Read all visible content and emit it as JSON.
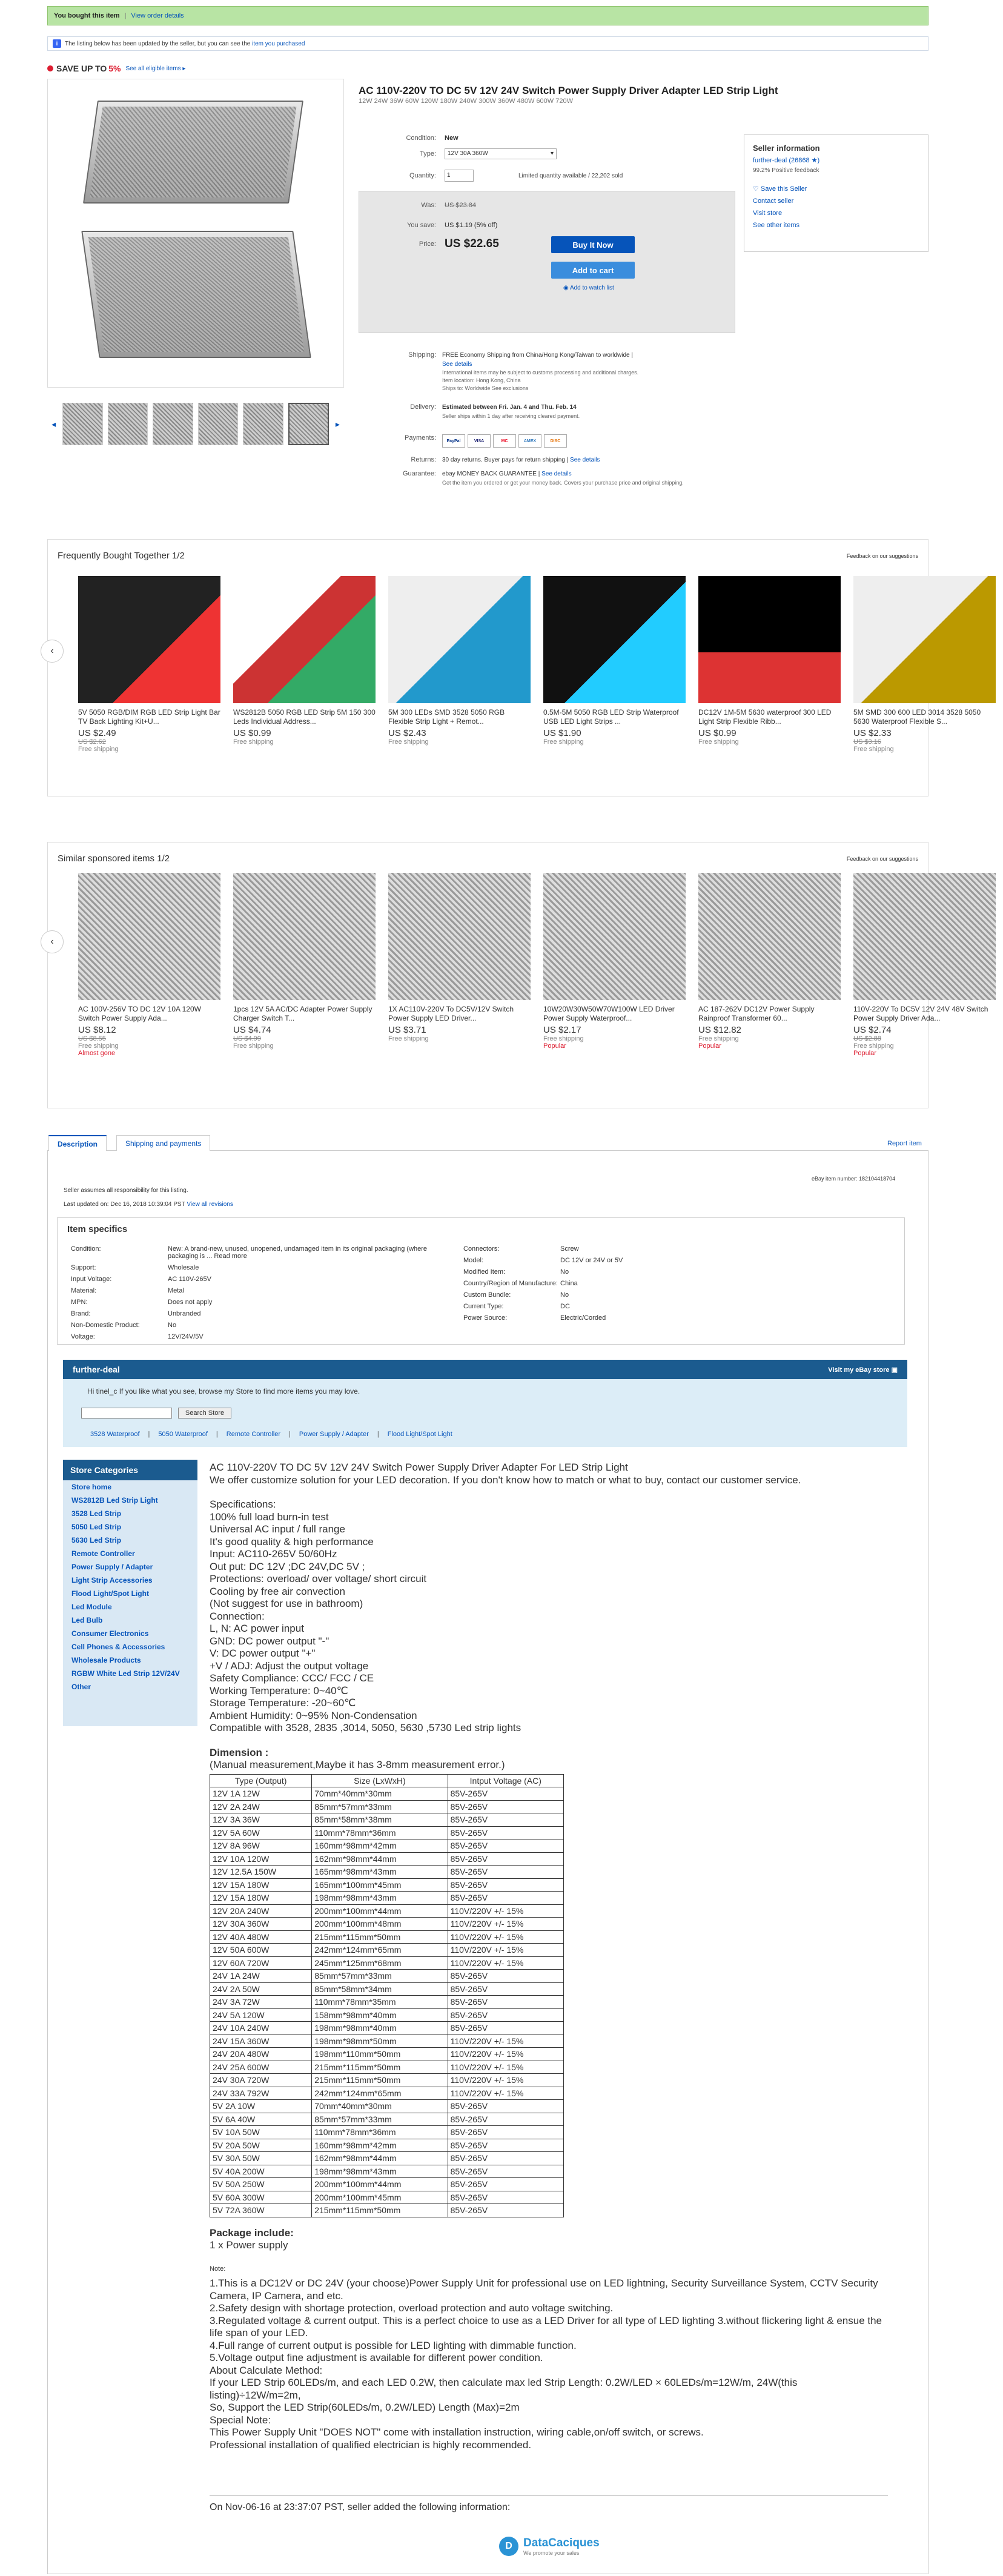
{
  "banner": {
    "bought": "You bought this item",
    "view_order": "View order details"
  },
  "update_notice": {
    "text": "The listing below has been updated by the seller, but you can see the",
    "link": "item you purchased"
  },
  "promo": {
    "save_up": "SAVE UP TO",
    "percent": "5%",
    "eligible": "See all eligible items ▸"
  },
  "item": {
    "title": "AC 110V-220V TO DC 5V 12V 24V Switch Power Supply Driver Adapter LED Strip Light",
    "subtitle": "12W 24W 36W 60W 120W 180W 240W 300W 360W 480W 600W 720W",
    "condition_label": "Condition:",
    "condition": "New",
    "type_label": "Type:",
    "type_value": "12V 30A 360W",
    "quantity_label": "Quantity:",
    "quantity": "1",
    "availability": "Limited quantity available / 22,202 sold",
    "was_label": "Was:",
    "was": "US $23.84",
    "save_label": "You save:",
    "save": "US $1.19 (5% off)",
    "price_label": "Price:",
    "price": "US $22.65",
    "buy_now": "Buy It Now",
    "add_cart": "Add to cart",
    "watch": "Add to watch list"
  },
  "seller": {
    "heading": "Seller information",
    "name": "further-deal",
    "feedback": "(26868 ★)",
    "positive": "99.2% Positive feedback",
    "save": "Save this Seller",
    "contact": "Contact seller",
    "visit": "Visit store",
    "other": "See other items"
  },
  "shipping": {
    "shipping_label": "Shipping:",
    "shipping": "FREE  Economy Shipping from China/Hong Kong/Taiwan to worldwide |",
    "see_details": "See details",
    "intl_note": "International items may be subject to customs processing and additional charges.",
    "location": "Item location:  Hong Kong, China",
    "ships_to": "Ships to:  Worldwide  See exclusions",
    "delivery_label": "Delivery:",
    "delivery": "Estimated between Fri. Jan. 4 and Thu. Feb. 14",
    "delivery_note": "Seller ships within 1 day after receiving cleared payment.",
    "payments_label": "Payments:",
    "payments": [
      "PayPal",
      "VISA",
      "MC",
      "AMEX",
      "DISC"
    ],
    "returns_label": "Returns:",
    "returns": "30 day returns. Buyer pays for return shipping |",
    "returns_link": "See details",
    "guarantee_label": "Guarantee:",
    "guarantee": "ebay MONEY BACK GUARANTEE |",
    "guarantee_link": "See details",
    "guarantee_note": "Get the item you ordered or get your money back. Covers your purchase price and original shipping."
  },
  "fbt": {
    "heading": "Frequently Bought Together",
    "pager": "1/2",
    "feedback": "Feedback on our suggestions",
    "items": [
      {
        "title": "5V 5050 RGB/DIM RGB LED Strip Light Bar TV Back Lighting Kit+U...",
        "price": "US $2.49",
        "old": "US $2.62",
        "ship": "Free shipping"
      },
      {
        "title": "WS2812B 5050 RGB LED Strip 5M 150 300 Leds Individual Address...",
        "price": "US $0.99",
        "old": "",
        "ship": "Free shipping"
      },
      {
        "title": "5M 300 LEDs SMD 3528 5050 RGB Flexible Strip Light + Remot...",
        "price": "US $2.43",
        "old": "",
        "ship": "Free shipping"
      },
      {
        "title": "0.5M-5M 5050 RGB LED Strip Waterproof USB LED Light Strips ...",
        "price": "US $1.90",
        "old": "",
        "ship": "Free shipping"
      },
      {
        "title": "DC12V 1M-5M 5630 waterproof 300 LED Light Strip Flexible Ribb...",
        "price": "US $0.99",
        "old": "",
        "ship": "Free shipping"
      },
      {
        "title": "5M SMD 300 600 LED 3014 3528 5050 5630 Waterproof Flexible S...",
        "price": "US $2.33",
        "old": "US $3.16",
        "ship": "Free shipping"
      }
    ]
  },
  "sponsored": {
    "heading": "Similar sponsored items",
    "pager": "1/2",
    "feedback": "Feedback on our suggestions",
    "items": [
      {
        "title": "AC 100V-256V TO DC 12V 10A 120W Switch Power Supply Ada...",
        "price": "US $8.12",
        "old": "US $8.55",
        "ship": "Free shipping",
        "tag": "Almost gone"
      },
      {
        "title": "1pcs 12V 5A AC/DC Adapter Power Supply Charger Switch T...",
        "price": "US $4.74",
        "old": "US $4.99",
        "ship": "Free shipping",
        "tag": ""
      },
      {
        "title": "1X AC110V-220V To DC5V/12V Switch Power Supply LED Driver...",
        "price": "US $3.71",
        "old": "",
        "ship": "Free shipping",
        "tag": ""
      },
      {
        "title": "10W20W30W50W70W100W LED Driver Power Supply Waterproof...",
        "price": "US $2.17",
        "old": "",
        "ship": "Free shipping",
        "tag": "Popular"
      },
      {
        "title": "AC 187-262V DC12V Power Supply Rainproof Transformer 60...",
        "price": "US $12.82",
        "old": "",
        "ship": "Free shipping",
        "tag": "Popular"
      },
      {
        "title": "110V-220V To DC5V 12V 24V 48V Switch Power Supply Driver Ada...",
        "price": "US $2.74",
        "old": "US $2.88",
        "ship": "Free shipping",
        "tag": "Popular"
      }
    ]
  },
  "desc_tabs": {
    "description": "Description",
    "shipping": "Shipping and payments",
    "report": "Report item"
  },
  "desc_meta": {
    "responsibility": "Seller assumes all responsibility for this listing.",
    "last_updated": "Last updated on:  Dec 16, 2018 10:39:04 PST",
    "revisions": "View all revisions",
    "ebay_no": "eBay item number:    182104418704"
  },
  "specifics": {
    "heading": "Item specifics",
    "left": [
      {
        "k": "Condition:",
        "v": "New: A brand-new, unused, unopened, undamaged item in its original packaging (where packaging is ...  Read more"
      },
      {
        "k": "Support:",
        "v": "Wholesale"
      },
      {
        "k": "Input Voltage:",
        "v": "AC 110V-265V"
      },
      {
        "k": "Material:",
        "v": "Metal"
      },
      {
        "k": "MPN:",
        "v": "Does not apply"
      },
      {
        "k": "Brand:",
        "v": "Unbranded"
      },
      {
        "k": "Non-Domestic Product:",
        "v": "No"
      },
      {
        "k": "Voltage:",
        "v": "12V/24V/5V"
      }
    ],
    "right": [
      {
        "k": "Connectors:",
        "v": "Screw"
      },
      {
        "k": "Model:",
        "v": "DC 12V or 24V or 5V"
      },
      {
        "k": "Modified Item:",
        "v": "No"
      },
      {
        "k": "Country/Region of Manufacture:",
        "v": "China"
      },
      {
        "k": "Custom Bundle:",
        "v": "No"
      },
      {
        "k": "Current Type:",
        "v": "DC"
      },
      {
        "k": "Power Source:",
        "v": "Electric/Corded"
      }
    ]
  },
  "store": {
    "name": "further-deal",
    "visit": "Visit my eBay store",
    "hi": "Hi tinel_c  If you like what you see, browse my Store to find more items you may love.",
    "search_btn": "Search Store",
    "cats": [
      "3528 Waterproof",
      "5050 Waterproof",
      "Remote Controller",
      "Power Supply / Adapter",
      "Flood Light/Spot Light"
    ],
    "side_heading": "Store Categories",
    "side": [
      "Store home",
      "WS2812B Led Strip Light",
      "3528 Led Strip",
      "5050 Led Strip",
      "5630 Led Strip",
      "Remote Controller",
      "Power Supply / Adapter",
      "Light Strip Accessories",
      "Flood Light/Spot Light",
      "Led Module",
      "Led Bulb",
      "Consumer Electronics",
      "Cell Phones & Accessories",
      "Wholesale Products",
      "RGBW White Led Strip 12V/24V",
      "Other"
    ]
  },
  "description": {
    "title": "AC 110V-220V TO DC 5V 12V 24V Switch Power Supply Driver Adapter For LED Strip Light",
    "intro": "We offer customize solution for your LED decoration. If you don't know how to match or what to buy, contact our customer service.",
    "specs": "Specifications:\n100% full load burn-in test\nUniversal AC input / full range\nIt's good quality & high performance\nInput: AC110-265V 50/60Hz\nOut put: DC 12V  ;DC 24V,DC 5V  ;\nProtections: overload/ over voltage/ short circuit\nCooling by free air convection\n(Not suggest for use in bathroom)\nConnection:\nL, N: AC power input\nGND: DC power output \"-\"\nV: DC power output \"+\"\n+V / ADJ: Adjust the output voltage\nSafety Compliance: CCC/ FCC / CE\nWorking Temperature: 0~40℃\nStorage Temperature: -20~60℃\nAmbient Humidity: 0~95% Non-Condensation\nCompatible with 3528, 2835 ,3014, 5050, 5630 ,5730 Led strip lights",
    "dim_heading": "Dimension :",
    "dim_note": "(Manual measurement,Maybe it has 3-8mm measurement error.)",
    "table_head": [
      "Type (Output)",
      "Size (LxWxH)",
      "Intput Voltage (AC)"
    ],
    "table": [
      [
        "12V 1A 12W",
        "70mm*40mm*30mm",
        "85V-265V"
      ],
      [
        "12V 2A 24W",
        "85mm*57mm*33mm",
        "85V-265V"
      ],
      [
        "12V 3A 36W",
        "85mm*58mm*38mm",
        "85V-265V"
      ],
      [
        "12V 5A 60W",
        "110mm*78mm*36mm",
        "85V-265V"
      ],
      [
        "12V 8A 96W",
        "160mm*98mm*42mm",
        "85V-265V"
      ],
      [
        "12V 10A 120W",
        "162mm*98mm*44mm",
        "85V-265V"
      ],
      [
        "12V 12.5A 150W",
        "165mm*98mm*43mm",
        "85V-265V"
      ],
      [
        "12V 15A 180W",
        "165mm*100mm*45mm",
        "85V-265V"
      ],
      [
        "12V 15A 180W",
        "198mm*98mm*43mm",
        "85V-265V"
      ],
      [
        "12V 20A 240W",
        "200mm*100mm*44mm",
        "110V/220V +/- 15%"
      ],
      [
        "12V 30A 360W",
        "200mm*100mm*48mm",
        "110V/220V +/- 15%"
      ],
      [
        "12V 40A 480W",
        "215mm*115mm*50mm",
        "110V/220V +/- 15%"
      ],
      [
        "12V 50A 600W",
        "242mm*124mm*65mm",
        "110V/220V +/- 15%"
      ],
      [
        "12V 60A 720W",
        "245mm*125mm*68mm",
        "110V/220V +/- 15%"
      ],
      [
        "24V 1A 24W",
        "85mm*57mm*33mm",
        "85V-265V"
      ],
      [
        "24V 2A 50W",
        "85mm*58mm*34mm",
        "85V-265V"
      ],
      [
        "24V 3A 72W",
        "110mm*78mm*35mm",
        "85V-265V"
      ],
      [
        "24V 5A 120W",
        "158mm*98mm*40mm",
        "85V-265V"
      ],
      [
        "24V 10A 240W",
        "198mm*98mm*40mm",
        "85V-265V"
      ],
      [
        "24V 15A 360W",
        "198mm*98mm*50mm",
        "110V/220V +/- 15%"
      ],
      [
        "24V 20A 480W",
        "198mm*110mm*50mm",
        "110V/220V +/- 15%"
      ],
      [
        "24V 25A 600W",
        "215mm*115mm*50mm",
        "110V/220V +/- 15%"
      ],
      [
        "24V 30A 720W",
        "215mm*115mm*50mm",
        "110V/220V +/- 15%"
      ],
      [
        "24V 33A 792W",
        "242mm*124mm*65mm",
        "110V/220V +/- 15%"
      ],
      [
        "5V 2A 10W",
        "70mm*40mm*30mm",
        "85V-265V"
      ],
      [
        "5V 6A 40W",
        "85mm*57mm*33mm",
        "85V-265V"
      ],
      [
        "5V 10A 50W",
        "110mm*78mm*36mm",
        "85V-265V"
      ],
      [
        "5V 20A 50W",
        "160mm*98mm*42mm",
        "85V-265V"
      ],
      [
        "5V 30A 50W",
        "162mm*98mm*44mm",
        "85V-265V"
      ],
      [
        "5V 40A 200W",
        "198mm*98mm*43mm",
        "85V-265V"
      ],
      [
        "5V 50A 250W",
        "200mm*100mm*44mm",
        "85V-265V"
      ],
      [
        "5V 60A 300W",
        "200mm*100mm*45mm",
        "85V-265V"
      ],
      [
        "5V 72A 360W",
        "215mm*115mm*50mm",
        "85V-265V"
      ]
    ],
    "pkg_heading": "Package include:",
    "pkg": "1 x Power supply",
    "note_heading": "Note:",
    "notes": "1.This is a DC12V or DC 24V (your choose)Power Supply Unit for professional use on LED lightning, Security Surveillance System, CCTV Security Camera, IP Camera, and etc.\n2.Safety design with shortage protection, overload protection and auto voltage switching.\n3.Regulated voltage & current output. This is a perfect choice to use as a LED Driver for all type of LED lighting 3.without flickering light & ensue the life span of your LED.\n4.Full range of current output is possible for LED lighting with dimmable function.\n5.Voltage output fine adjustment is available for different power condition.\nAbout Calculate Method:\nIf your LED Strip 60LEDs/m, and each LED 0.2W, then calculate max led Strip Length: 0.2W/LED × 60LEDs/m=12W/m, 24W(this listing)÷12W/m=2m,\nSo, Support the LED Strip(60LEDs/m, 0.2W/LED) Length (Max)=2m\nSpecial Note:\nThis Power Supply Unit \"DOES NOT\" come with installation instruction, wiring cable,on/off switch, or screws.\nProfessional installation of qualified electrician is highly recommended."
  },
  "footer": {
    "added": "On Nov-06-16 at 23:37:07 PST, seller added the following information:",
    "logo": "DataCaciques",
    "logo_sub": "We promote your sales"
  }
}
